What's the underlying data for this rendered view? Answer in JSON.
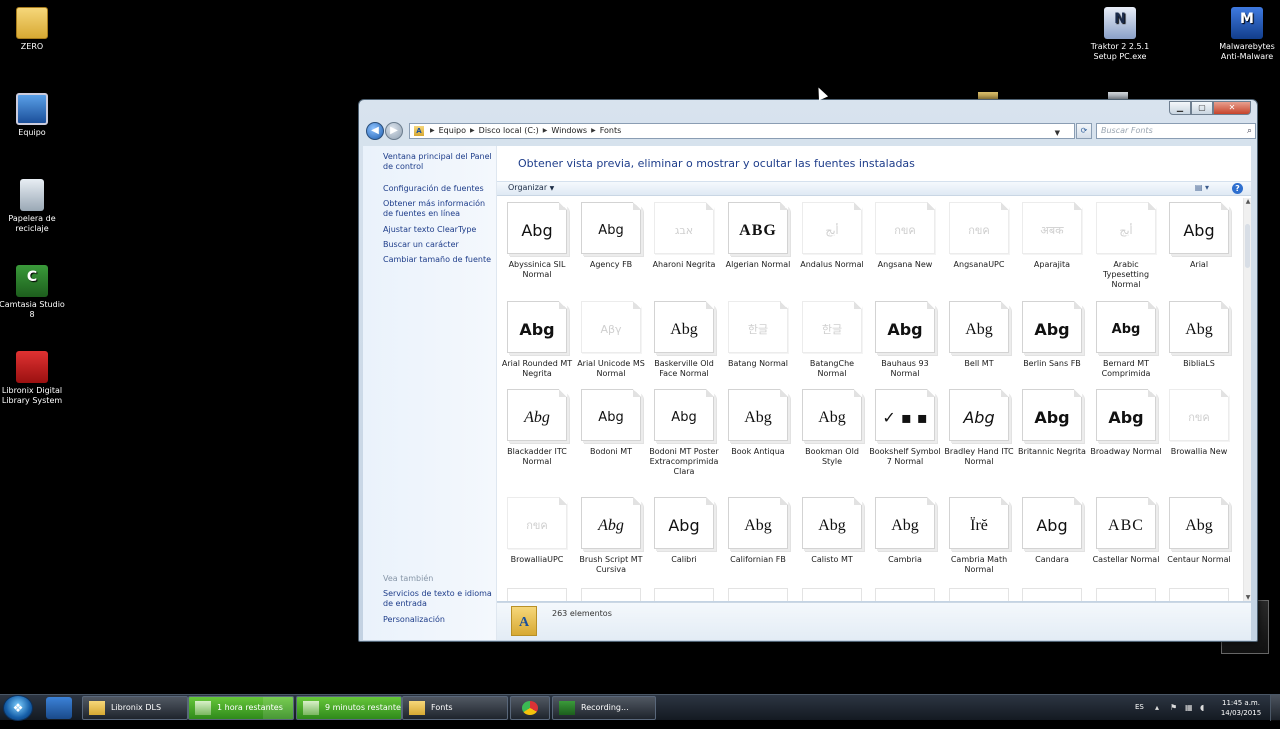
{
  "desktop_icons": [
    {
      "label": "ZERO",
      "icon": "folder-icon"
    },
    {
      "label": "Equipo",
      "icon": "computer-icon"
    },
    {
      "label": "Papelera de reciclaje",
      "icon": "recycle-bin-icon"
    },
    {
      "label": "Camtasia Studio 8",
      "icon": "camtasia-icon"
    },
    {
      "label": "Libronix Digital Library System",
      "icon": "libronix-icon"
    },
    {
      "label": "Traktor 2 2.5.1 Setup PC.exe",
      "icon": "installer-icon"
    },
    {
      "label": "Malwarebytes Anti-Malware",
      "icon": "malwarebytes-icon"
    }
  ],
  "window": {
    "breadcrumb": [
      "Equipo",
      "Disco local (C:)",
      "Windows",
      "Fonts"
    ],
    "search_placeholder": "Buscar Fonts",
    "left_tasks": [
      "Ventana principal del Panel de control",
      "Configuración de fuentes",
      "Obtener más información de fuentes en línea",
      "Ajustar texto ClearType",
      "Buscar un carácter",
      "Cambiar tamaño de fuente"
    ],
    "see_also_title": "Vea también",
    "see_also": [
      "Servicios de texto e idioma de entrada",
      "Personalización"
    ],
    "heading": "Obtener vista previa, eliminar o mostrar y ocultar las fuentes instaladas",
    "organize_label": "Organizar",
    "item_count": "263 elementos"
  },
  "fonts": [
    {
      "name": "Abyssinica SIL Normal",
      "sample": "Abg"
    },
    {
      "name": "Agency FB",
      "sample": "Abg"
    },
    {
      "name": "Aharoni Negrita",
      "sample": "אבג"
    },
    {
      "name": "Algerian Normal",
      "sample": "ABG"
    },
    {
      "name": "Andalus Normal",
      "sample": "أبج"
    },
    {
      "name": "Angsana New",
      "sample": "กขค"
    },
    {
      "name": "AngsanaUPC",
      "sample": "กขค"
    },
    {
      "name": "Aparajita",
      "sample": "अबक"
    },
    {
      "name": "Arabic Typesetting Normal",
      "sample": "أبج"
    },
    {
      "name": "Arial",
      "sample": "Abg"
    },
    {
      "name": "Arial Rounded MT Negrita",
      "sample": "Abg"
    },
    {
      "name": "Arial Unicode MS Normal",
      "sample": "Αβγ"
    },
    {
      "name": "Baskerville Old Face Normal",
      "sample": "Abg"
    },
    {
      "name": "Batang Normal",
      "sample": "한글"
    },
    {
      "name": "BatangChe Normal",
      "sample": "한글"
    },
    {
      "name": "Bauhaus 93 Normal",
      "sample": "Abg"
    },
    {
      "name": "Bell MT",
      "sample": "Abg"
    },
    {
      "name": "Berlin Sans FB",
      "sample": "Abg"
    },
    {
      "name": "Bernard MT Comprimida",
      "sample": "Abg"
    },
    {
      "name": "BibliaLS",
      "sample": "Abg"
    },
    {
      "name": "Blackadder ITC Normal",
      "sample": "Abg"
    },
    {
      "name": "Bodoni MT",
      "sample": "Abg"
    },
    {
      "name": "Bodoni MT Poster Extracomprimida Clara",
      "sample": "Abg"
    },
    {
      "name": "Book Antiqua",
      "sample": "Abg"
    },
    {
      "name": "Bookman Old Style",
      "sample": "Abg"
    },
    {
      "name": "Bookshelf Symbol 7 Normal",
      "sample": "✓ ▪ ▪"
    },
    {
      "name": "Bradley Hand ITC Normal",
      "sample": "Abg"
    },
    {
      "name": "Britannic Negrita",
      "sample": "Abg"
    },
    {
      "name": "Broadway Normal",
      "sample": "Abg"
    },
    {
      "name": "Browallia New",
      "sample": "กขค"
    },
    {
      "name": "BrowalliaUPC",
      "sample": "กขค"
    },
    {
      "name": "Brush Script MT Cursiva",
      "sample": "Abg"
    },
    {
      "name": "Calibri",
      "sample": "Abg"
    },
    {
      "name": "Californian FB",
      "sample": "Abg"
    },
    {
      "name": "Calisto MT",
      "sample": "Abg"
    },
    {
      "name": "Cambria",
      "sample": "Abg"
    },
    {
      "name": "Cambria Math Normal",
      "sample": "Ïrĕ"
    },
    {
      "name": "Candara",
      "sample": "Abg"
    },
    {
      "name": "Castellar Normal",
      "sample": "ABC"
    },
    {
      "name": "Centaur Normal",
      "sample": "Abg"
    }
  ],
  "taskbar": {
    "tasks": [
      {
        "label": "Libronix DLS"
      },
      {
        "label": "1 hora restantes"
      },
      {
        "label": "9 minutos restantes"
      },
      {
        "label": "Fonts"
      },
      {
        "label": ""
      },
      {
        "label": "Recording..."
      }
    ],
    "language": "ES",
    "time": "11:45 a.m.",
    "date": "14/03/2015"
  }
}
